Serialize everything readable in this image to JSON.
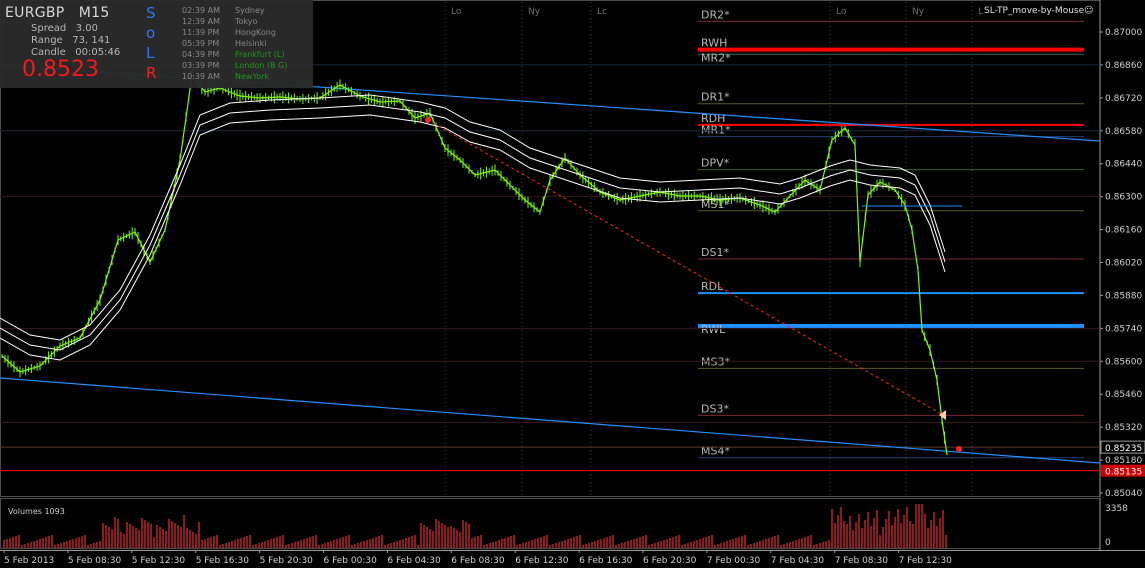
{
  "info": {
    "symbol": "EURGBP",
    "timeframe": "M15",
    "spread_label": "Spread",
    "spread_value": "3.00",
    "range_label": "Range",
    "range_value": "73, 141",
    "candle_label": "Candle",
    "candle_value": "00:05:46",
    "current_price": "0.8523",
    "vertical_letters": [
      "S",
      "o",
      "L",
      "R"
    ],
    "sessions": [
      {
        "time": "02:39 AM",
        "name": "Sydney"
      },
      {
        "time": "12:39 AM",
        "name": "Tokyo"
      },
      {
        "time": "11:39 PM",
        "name": "HongKong"
      },
      {
        "time": "05:39 PM",
        "name": "Helsinki"
      },
      {
        "time": "04:39 PM",
        "name": "Frankfurt  (L)"
      },
      {
        "time": "03:39 PM",
        "name": "London  (B G)"
      },
      {
        "time": "10:39 AM",
        "name": "NewYork"
      }
    ]
  },
  "indicator_label": "SL-TP_move-by-Mouse",
  "smiley_icon": "☺",
  "session_markers": [
    {
      "label": "Lo"
    },
    {
      "label": "Ny"
    },
    {
      "label": "Lc"
    },
    {
      "label": "Lo"
    },
    {
      "label": "Ny"
    },
    {
      "label": "L"
    }
  ],
  "pivot_levels": [
    {
      "label": "DR2*",
      "price": 0.87045
    },
    {
      "label": "RWH",
      "price": 0.86925
    },
    {
      "label": "MR2*",
      "price": 0.86905
    },
    {
      "label": "DR1*",
      "price": 0.86695
    },
    {
      "label": "RDH",
      "price": 0.86605
    },
    {
      "label": "MR1*",
      "price": 0.86555
    },
    {
      "label": "DPV*",
      "price": 0.86415
    },
    {
      "label": "MS1*",
      "price": 0.8624
    },
    {
      "label": "DS1*",
      "price": 0.86035
    },
    {
      "label": "RDL",
      "price": 0.8589
    },
    {
      "label": "RWL",
      "price": 0.8575
    },
    {
      "label": "MS3*",
      "price": 0.8557
    },
    {
      "label": "DS3*",
      "price": 0.8537
    },
    {
      "label": "MS4*",
      "price": 0.8519
    }
  ],
  "price_axis": {
    "ticks": [
      "0.87000",
      "0.86860",
      "0.86720",
      "0.86580",
      "0.86440",
      "0.86300",
      "0.86160",
      "0.86020",
      "0.85880",
      "0.85740",
      "0.85600",
      "0.85460",
      "0.85320",
      "0.85180",
      "0.85040"
    ],
    "bid_label": "0.85235",
    "ask_label": "0.85135"
  },
  "time_axis": {
    "labels": [
      "5 Feb 2013",
      "5 Feb 08:30",
      "5 Feb 12:30",
      "5 Feb 16:30",
      "5 Feb 20:30",
      "6 Feb 00:30",
      "6 Feb 04:30",
      "6 Feb 08:30",
      "6 Feb 12:30",
      "6 Feb 16:30",
      "6 Feb 20:30",
      "7 Feb 00:30",
      "7 Feb 04:30",
      "7 Feb 08:30",
      "7 Feb 12:30"
    ]
  },
  "volume": {
    "label": "Volumes 1093",
    "max_tick": "3358",
    "zero_tick": "0"
  },
  "colors": {
    "background": "#000000",
    "candle": "#7CFC00",
    "channel": "#1E90FF",
    "support_line": "#1E90FF",
    "resistance_line": "#FF0000",
    "ma_bands": "#FFFFFF",
    "trend_dashed": "#FF2020",
    "volume_bar": "#B22222"
  }
}
